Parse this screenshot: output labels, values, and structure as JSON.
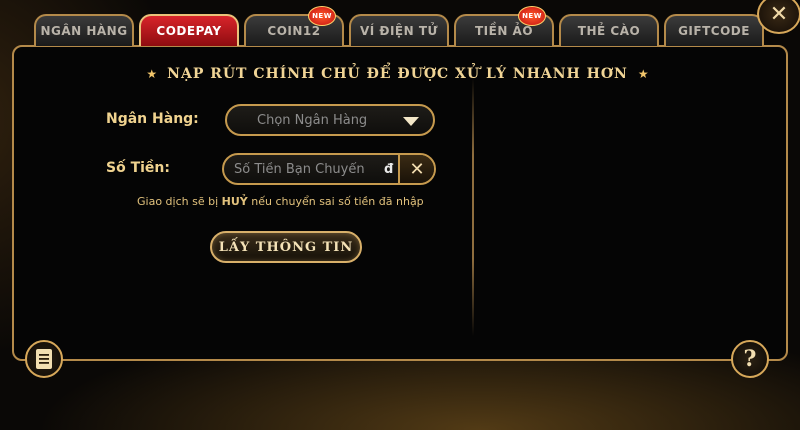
{
  "tabs": [
    {
      "label": "NGÂN HÀNG",
      "active": false,
      "badge": ""
    },
    {
      "label": "CODEPAY",
      "active": true,
      "badge": ""
    },
    {
      "label": "COIN12",
      "active": false,
      "badge": "NEW"
    },
    {
      "label": "VÍ ĐIỆN TỬ",
      "active": false,
      "badge": ""
    },
    {
      "label": "TIỀN ẢO",
      "active": false,
      "badge": "NEW"
    },
    {
      "label": "THẺ CÀO",
      "active": false,
      "badge": ""
    },
    {
      "label": "GIFTCODE",
      "active": false,
      "badge": ""
    }
  ],
  "headline": "NẠP RÚT CHÍNH CHỦ ĐỂ ĐƯỢC XỬ LÝ NHANH HƠN",
  "form": {
    "bank_label": "Ngân Hàng:",
    "bank_value": "Chọn Ngân Hàng",
    "amount_label": "Số Tiền:",
    "amount_placeholder": "Số Tiền Bạn Chuyển",
    "amount_suffix": "đ",
    "note_prefix": "Giao dịch sẽ bị ",
    "note_emphasis": "HUỶ",
    "note_suffix": " nếu chuyển sai số tiền đã nhập",
    "submit_label": "LẤY THÔNG TIN"
  },
  "icons": {
    "close": "close-icon",
    "menu": "document-list-icon",
    "help": "question-icon",
    "caret": "chevron-down-icon",
    "clear": "clear-x-icon"
  },
  "colors": {
    "accent_gold": "#c69a4e",
    "active_tab_red": "#c8161c",
    "text_gold": "#f0d38f"
  }
}
